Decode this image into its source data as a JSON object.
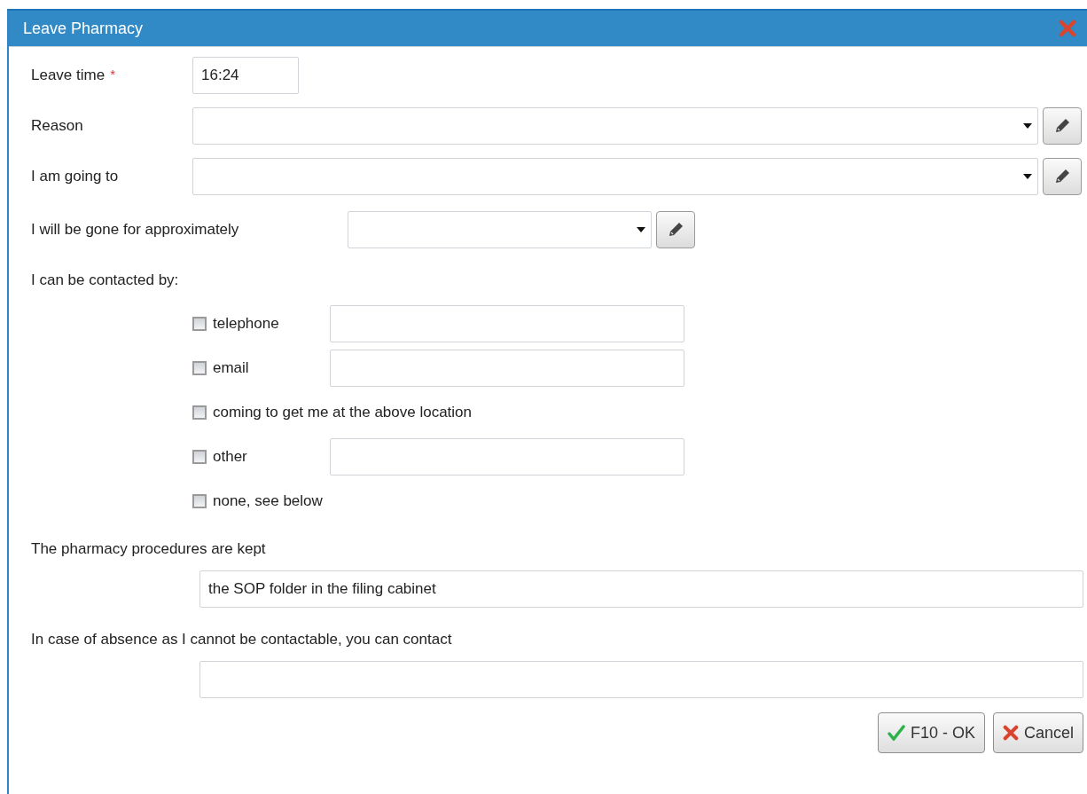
{
  "dialog": {
    "title": "Leave Pharmacy"
  },
  "leave_time": {
    "label": "Leave time",
    "required_mark": "*",
    "value": "16:24"
  },
  "dropdowns": [
    {
      "label": "Reason",
      "kind": "wide"
    },
    {
      "label": "I am going to",
      "kind": "wide"
    },
    {
      "label": "I will be gone for approximately",
      "kind": "narrow"
    }
  ],
  "contact_heading": "I can be contacted by:",
  "contact_options": [
    {
      "label": "telephone",
      "checked": false,
      "kind": "field"
    },
    {
      "label": "email",
      "checked": false,
      "kind": "field"
    },
    {
      "label": "coming to get me at the above location",
      "checked": false,
      "kind": "plain"
    },
    {
      "label": "other",
      "checked": false,
      "kind": "field"
    },
    {
      "label": "none, see below",
      "checked": false,
      "kind": "plain"
    }
  ],
  "procedures": {
    "label": "The pharmacy procedures are kept",
    "value": "the SOP folder in the filing cabinet"
  },
  "absence": {
    "label": "In case of absence as I cannot be contactable, you can contact"
  },
  "buttons": [
    {
      "label": "F10 - OK",
      "kind": "ok"
    },
    {
      "label": "Cancel",
      "kind": "cancel"
    }
  ]
}
